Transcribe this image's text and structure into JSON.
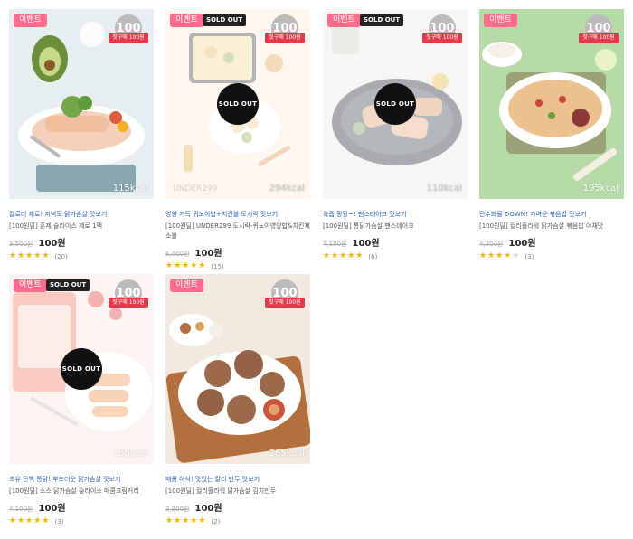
{
  "labels": {
    "event": "이벤트",
    "soldout_tag": "SOLD OUT",
    "soldout_overlay": "SOLD OUT",
    "stamp_number": "100",
    "stamp_ribbon": "첫구매 100원"
  },
  "products": [
    {
      "title": "칼로리 제로! 저녁도 닭가슴살 맛보기",
      "name": "[100원딜] 훈제 슬라이스 제로 1팩",
      "kcal": "115kcal",
      "original_price": "3,500원",
      "price": "100원",
      "rating": 5,
      "review_count": "(20)",
      "sold_out": false,
      "has_stamp": true,
      "colors": {
        "bg": "#dfe8ea",
        "plate": "#f7f7f7",
        "food": "#f0c4a7",
        "accent": "#7aa84a"
      }
    },
    {
      "title": "영양 가득 퀴노아밥+치킨볼 도시락 맛보기",
      "name": "[100원딜] UNDER299 도시락-퀴노아영양밥&치킨채소볼",
      "under_label": "UNDER299",
      "kcal": "294kcal",
      "original_price": "6,000원",
      "price": "100원",
      "rating": 4.5,
      "review_count": "(15)",
      "sold_out": true,
      "has_stamp": true,
      "colors": {
        "bg": "#fbf0df",
        "plate": "#ffffff",
        "food": "#f3dca6",
        "accent": "#e7b561"
      }
    },
    {
      "title": "육즙 팡팡~! 팬스테이크 맛보기",
      "name": "[100원딜] 통닭가슴살 팬스테이크",
      "kcal": "110kcal",
      "original_price": "4,100원",
      "price": "100원",
      "rating": 5,
      "review_count": "(6)",
      "sold_out": true,
      "has_stamp": true,
      "colors": {
        "bg": "#e9e6e2",
        "plate": "#40454e",
        "food": "#e7ab83",
        "accent": "#8da86a"
      }
    },
    {
      "title": "탄수화물 DOWN! 가벼운 볶음밥 맛보기",
      "name": "[100원딜] 컬리플라워 닭가슴살 볶음밥 야채맛",
      "kcal": "195kcal",
      "original_price": "4,300원",
      "price": "100원",
      "rating": 4,
      "review_count": "(3)",
      "sold_out": false,
      "has_stamp": true,
      "colors": {
        "bg": "#b3d9a6",
        "plate": "#ffffff",
        "food": "#e8b98a",
        "accent": "#c9463a"
      }
    },
    {
      "title": "초유 단백 통닭! 부드러운 닭가슴살 맛보기",
      "name": "[100원딜] 소스 닭가슴살 슬라이스 매콤크림커리",
      "kcal": "160kcal",
      "original_price": "4,100원",
      "price": "100원",
      "rating": 4.5,
      "review_count": "(3)",
      "sold_out": true,
      "has_stamp": true,
      "colors": {
        "bg": "#f7e4de",
        "plate": "#ffffff",
        "food": "#f0a46a",
        "accent": "#e3564a"
      }
    },
    {
      "title": "매콤 아삭! 맛있는 칼리 만두 맛보기",
      "name": "[100원딜] 컬리플라워 닭가슴살 김치만두",
      "kcal": "265kcal",
      "original_price": "3,900원",
      "price": "100원",
      "rating": 5,
      "review_count": "(2)",
      "sold_out": false,
      "has_stamp": true,
      "colors": {
        "bg": "#f3e7dc",
        "plate": "#ffffff",
        "food": "#9b6a4a",
        "accent": "#b3703f"
      }
    }
  ]
}
